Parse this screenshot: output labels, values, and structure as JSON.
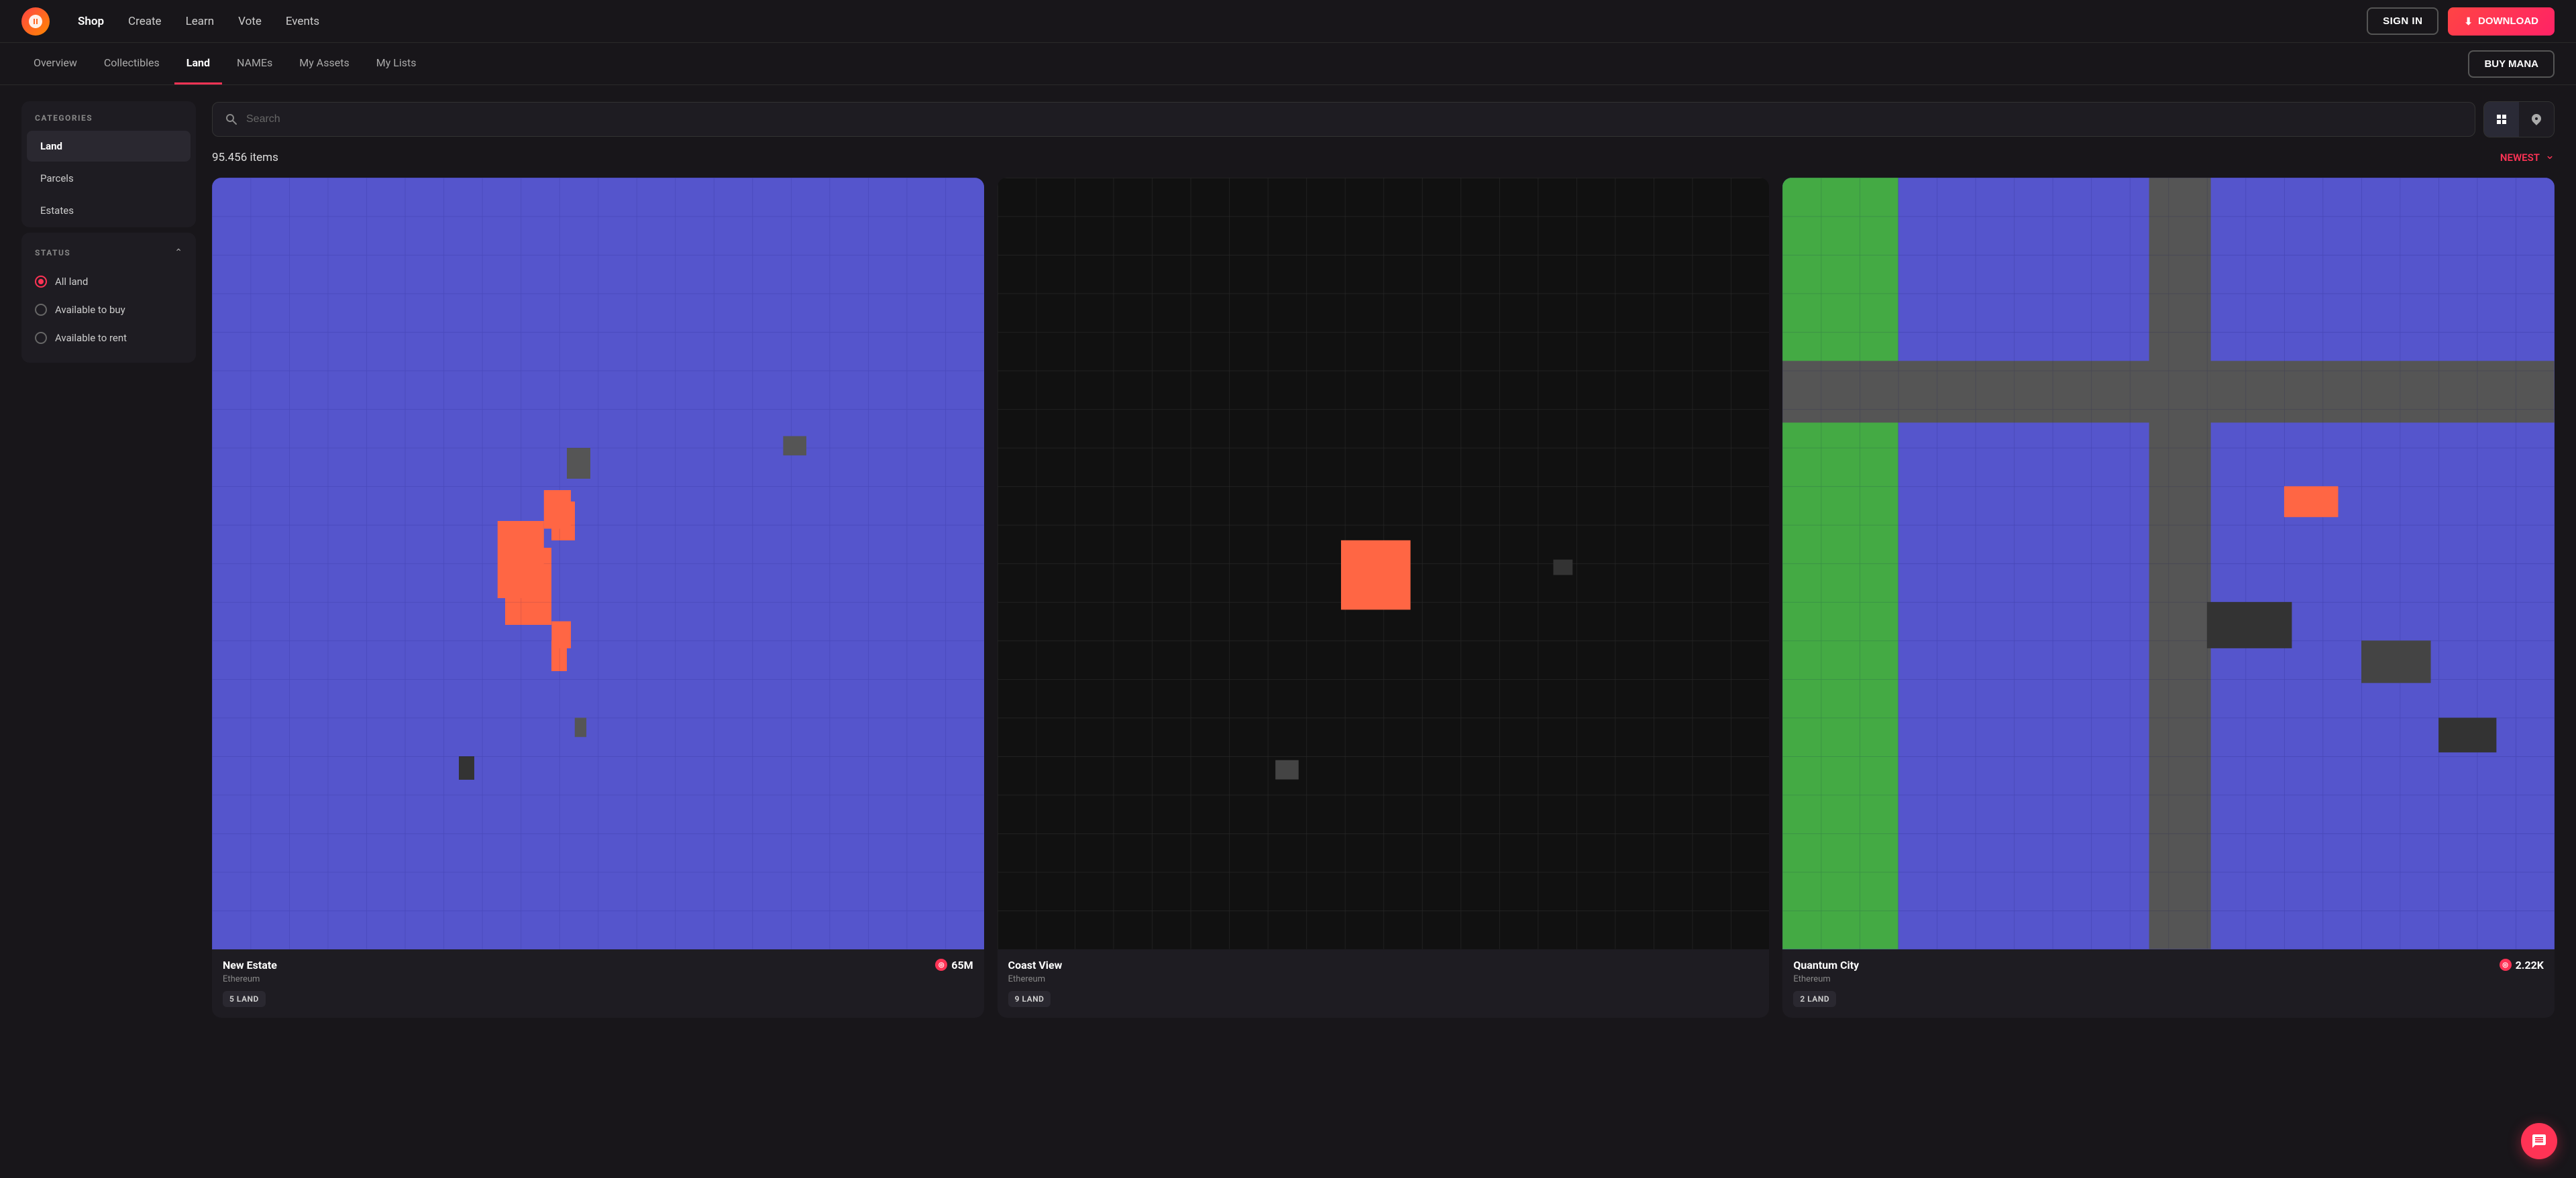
{
  "app": {
    "logo_alt": "Decentraland Logo"
  },
  "navbar": {
    "nav_items": [
      {
        "label": "Shop",
        "active": true
      },
      {
        "label": "Create",
        "active": false
      },
      {
        "label": "Learn",
        "active": false
      },
      {
        "label": "Vote",
        "active": false
      },
      {
        "label": "Events",
        "active": false
      }
    ],
    "sign_in_label": "SIGN IN",
    "download_label": "DOWNLOAD",
    "download_icon": "⬇"
  },
  "tabs": {
    "items": [
      {
        "label": "Overview",
        "active": false
      },
      {
        "label": "Collectibles",
        "active": false
      },
      {
        "label": "Land",
        "active": true
      },
      {
        "label": "NAMEs",
        "active": false
      },
      {
        "label": "My Assets",
        "active": false
      },
      {
        "label": "My Lists",
        "active": false
      }
    ],
    "buy_mana_label": "BUY MANA"
  },
  "sidebar": {
    "categories_label": "CATEGORIES",
    "category_items": [
      {
        "label": "Land",
        "active": true
      },
      {
        "label": "Parcels",
        "active": false
      },
      {
        "label": "Estates",
        "active": false
      }
    ],
    "status_label": "STATUS",
    "status_items": [
      {
        "label": "All land",
        "checked": true
      },
      {
        "label": "Available to buy",
        "checked": false
      },
      {
        "label": "Available to rent",
        "checked": false
      }
    ]
  },
  "search": {
    "placeholder": "Search"
  },
  "results": {
    "count": "95.456 items",
    "sort_label": "NEWEST"
  },
  "cards": [
    {
      "title": "New Estate",
      "network": "Ethereum",
      "price": "65M",
      "badge": "5 LAND",
      "map_type": "blue_pixels"
    },
    {
      "title": "Coast View",
      "network": "Ethereum",
      "price": "",
      "badge": "9 LAND",
      "map_type": "dark_pixels"
    },
    {
      "title": "Quantum City",
      "network": "Ethereum",
      "price": "2.22K",
      "badge": "2 LAND",
      "map_type": "blue_roads"
    }
  ]
}
